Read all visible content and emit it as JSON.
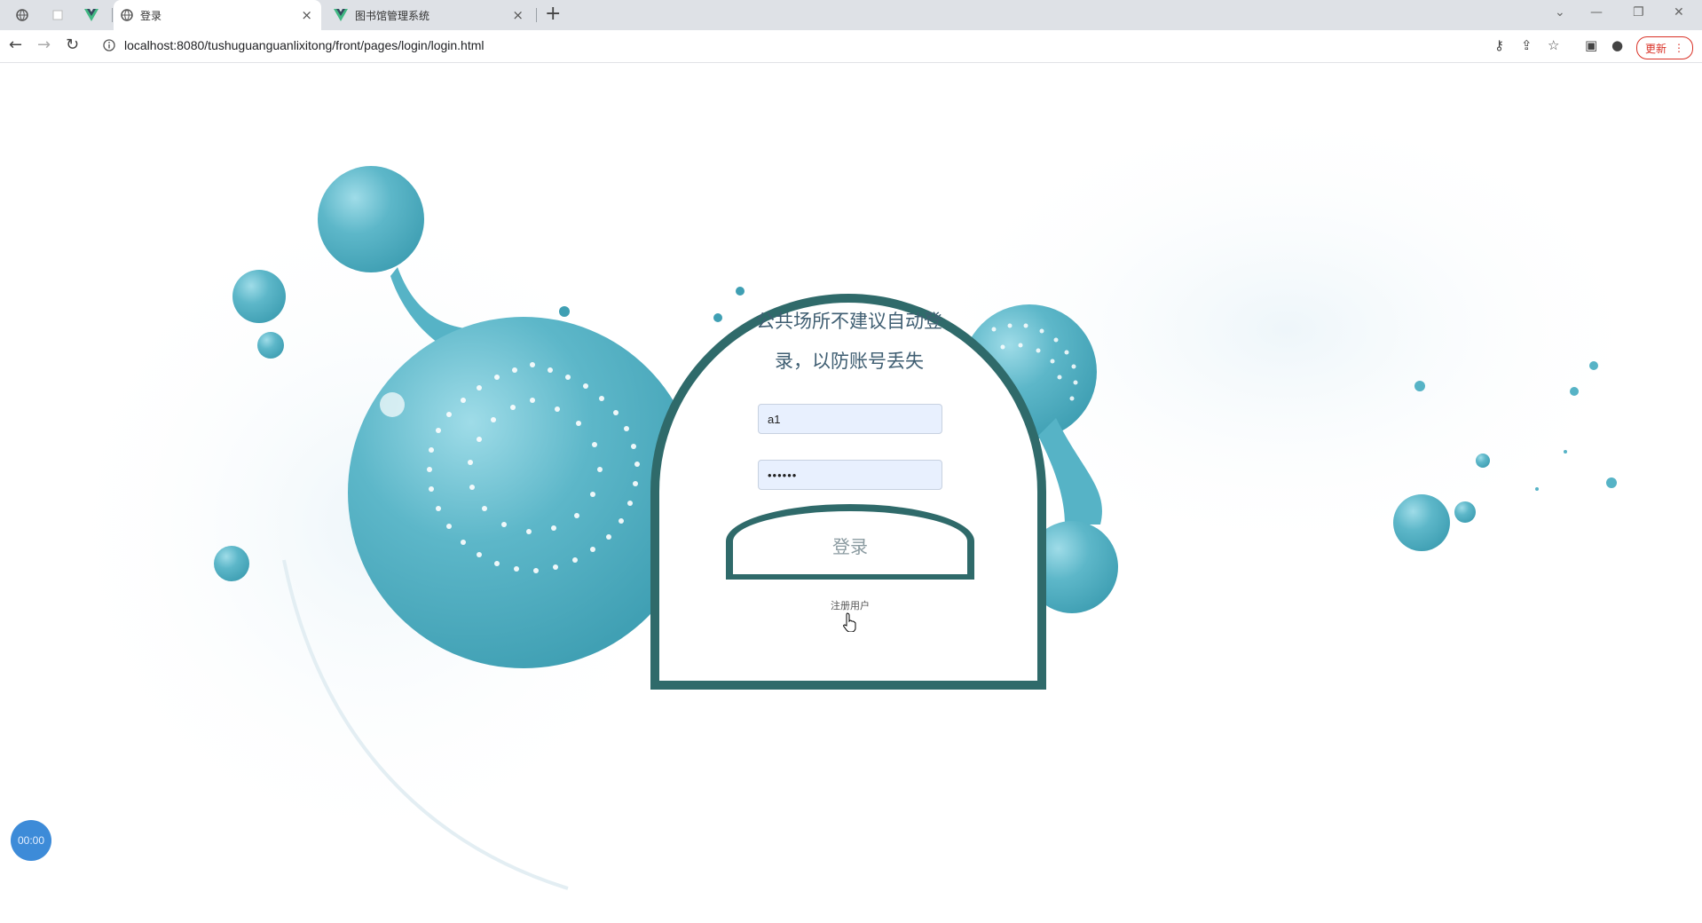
{
  "browser": {
    "tabs": [
      {
        "title": "",
        "icon": "globe-icon"
      },
      {
        "title": "",
        "icon": "blank-tab-icon"
      },
      {
        "title": "",
        "icon": "vue-logo-icon"
      },
      {
        "title": "登录",
        "icon": "globe-icon",
        "active": true
      },
      {
        "title": "图书馆管理系统",
        "icon": "vue-logo-icon"
      }
    ],
    "url": "localhost:8080/tushuguanguanlixitong/front/pages/login/login.html",
    "update_label": "更新"
  },
  "login": {
    "notice_line1": "公共场所不建议自动登",
    "notice_line2": "录，以防账号丢失",
    "username_value": "a1",
    "password_value": "••••••",
    "submit_label": "登录",
    "register_label": "注册用户"
  },
  "recorder": {
    "time": "00:00"
  },
  "colors": {
    "accent": "#2f6a6a",
    "bubble": "#56b3c6",
    "input_bg": "#e8f0fe"
  }
}
